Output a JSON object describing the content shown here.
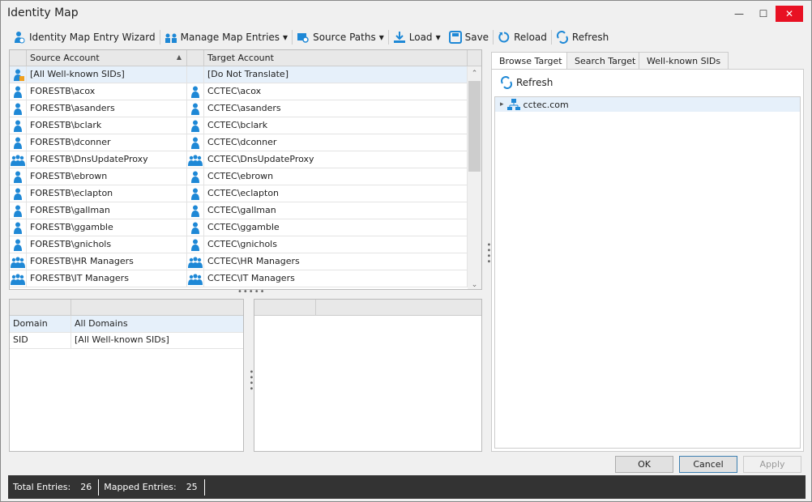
{
  "window": {
    "title": "Identity Map",
    "minimize": "—",
    "maximize": "☐",
    "close": "✕"
  },
  "toolbar": {
    "wizard": "Identity Map Entry Wizard",
    "manage": "Manage Map Entries",
    "source_paths": "Source Paths",
    "load": "Load",
    "save": "Save",
    "reload": "Reload",
    "refresh": "Refresh",
    "dropdown": "▾"
  },
  "map_grid": {
    "col_source": "Source Account",
    "col_target": "Target Account",
    "sort": "▲",
    "rows": [
      {
        "source": "[All Well-known SIDs]",
        "target": "[Do Not Translate]",
        "type": "special"
      },
      {
        "source": "FORESTB\\acox",
        "target": "CCTEC\\acox",
        "type": "user"
      },
      {
        "source": "FORESTB\\asanders",
        "target": "CCTEC\\asanders",
        "type": "user"
      },
      {
        "source": "FORESTB\\bclark",
        "target": "CCTEC\\bclark",
        "type": "user"
      },
      {
        "source": "FORESTB\\dconner",
        "target": "CCTEC\\dconner",
        "type": "user"
      },
      {
        "source": "FORESTB\\DnsUpdateProxy",
        "target": "CCTEC\\DnsUpdateProxy",
        "type": "group"
      },
      {
        "source": "FORESTB\\ebrown",
        "target": "CCTEC\\ebrown",
        "type": "user"
      },
      {
        "source": "FORESTB\\eclapton",
        "target": "CCTEC\\eclapton",
        "type": "user"
      },
      {
        "source": "FORESTB\\gallman",
        "target": "CCTEC\\gallman",
        "type": "user"
      },
      {
        "source": "FORESTB\\ggamble",
        "target": "CCTEC\\ggamble",
        "type": "user"
      },
      {
        "source": "FORESTB\\gnichols",
        "target": "CCTEC\\gnichols",
        "type": "user"
      },
      {
        "source": "FORESTB\\HR Managers",
        "target": "CCTEC\\HR Managers",
        "type": "group"
      },
      {
        "source": "FORESTB\\IT Managers",
        "target": "CCTEC\\IT Managers",
        "type": "group"
      }
    ]
  },
  "details": {
    "rows": [
      {
        "name": "Domain",
        "value": "All Domains"
      },
      {
        "name": "SID",
        "value": "[All Well-known SIDs]"
      }
    ]
  },
  "right": {
    "tabs": [
      "Browse Target",
      "Search Target",
      "Well-known SIDs"
    ],
    "refresh": "Refresh",
    "tree": [
      {
        "label": "cctec.com",
        "expander": "▸"
      }
    ]
  },
  "buttons": {
    "ok": "OK",
    "cancel": "Cancel",
    "apply": "Apply"
  },
  "status": {
    "total_label": "Total Entries:",
    "total": "26",
    "mapped_label": "Mapped Entries:",
    "mapped": "25"
  },
  "colors": {
    "accent": "#1e88d6",
    "status_bg": "#333333",
    "selected": "#e6f0fa"
  }
}
